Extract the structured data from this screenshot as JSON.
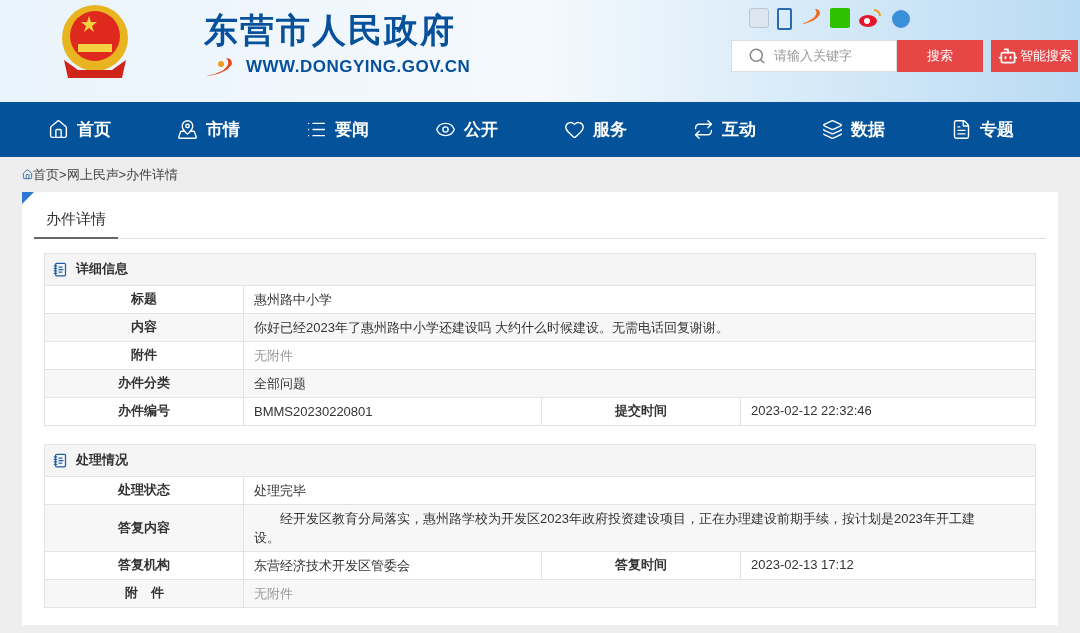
{
  "header": {
    "site_title": "东营市人民政府",
    "site_url": "WWW.DONGYING.GOV.CN",
    "search": {
      "placeholder": "请输入关键字",
      "button": "搜索",
      "smart_button": "智能搜索"
    }
  },
  "nav": [
    {
      "label": "首页"
    },
    {
      "label": "市情"
    },
    {
      "label": "要闻"
    },
    {
      "label": "公开"
    },
    {
      "label": "服务"
    },
    {
      "label": "互动"
    },
    {
      "label": "数据"
    },
    {
      "label": "专题"
    }
  ],
  "breadcrumb": [
    "首页",
    ">网上民声",
    ">办件详情"
  ],
  "page_tab": "办件详情",
  "sections": [
    {
      "title": "详细信息",
      "rows": [
        {
          "label": "标题",
          "value": "惠州路中小学",
          "muted": false
        },
        {
          "label": "内容",
          "value": "你好已经2023年了惠州路中小学还建设吗 大约什么时候建设。无需电话回复谢谢。",
          "muted": false
        },
        {
          "label": "附件",
          "value": "无附件",
          "muted": true
        },
        {
          "label": "办件分类",
          "value": "全部问题",
          "muted": false
        },
        {
          "label": "办件编号",
          "value": "BMMS20230220801",
          "muted": false,
          "label2": "提交时间",
          "value2": "2023-02-12 22:32:46"
        }
      ]
    },
    {
      "title": "处理情况",
      "rows": [
        {
          "label": "处理状态",
          "value": "处理完毕",
          "muted": false
        },
        {
          "label": "答复内容",
          "value": "经开发区教育分局落实，惠州路学校为开发区2023年政府投资建设项目，正在办理建设前期手续，按计划是2023年开工建设。",
          "muted": false,
          "indent": true
        },
        {
          "label": "答复机构",
          "value": "东营经济技术开发区管委会",
          "muted": false,
          "label2": "答复时间",
          "value2": "2023-02-13 17:12"
        },
        {
          "label": "附　件",
          "value": "无附件",
          "muted": true
        }
      ]
    }
  ]
}
